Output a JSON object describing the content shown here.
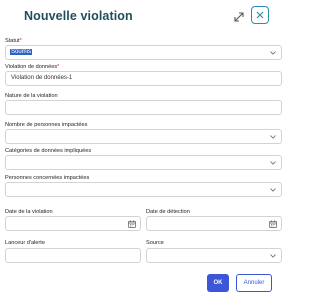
{
  "dialog": {
    "title": "Nouvelle violation",
    "ok_label": "OK",
    "cancel_label": "Annuler"
  },
  "fields": {
    "statut": {
      "label": "Statut",
      "required": "*",
      "value": "Soumis"
    },
    "violation": {
      "label": "Violation de données",
      "required": "*",
      "value": "Violation de données-1"
    },
    "nature": {
      "label": "Nature de la violation",
      "value": ""
    },
    "nb_personnes": {
      "label": "Nombre de personnes impactées",
      "value": ""
    },
    "categories": {
      "label": "Catégories de données impliquées",
      "value": ""
    },
    "personnes_concernees": {
      "label": "Personnes concernées impactées",
      "value": ""
    },
    "date_violation": {
      "label": "Date de la violation",
      "value": ""
    },
    "date_detection": {
      "label": "Date de détection",
      "value": ""
    },
    "lanceur": {
      "label": "Lanceur d'alerte",
      "value": ""
    },
    "source": {
      "label": "Source",
      "value": ""
    }
  },
  "colors": {
    "accent": "#3b56d9",
    "title": "#1f4e5c",
    "close_border": "#2a8fb0",
    "required": "#d0312d"
  },
  "icons": [
    "expand-icon",
    "close-icon",
    "chevron-down-icon",
    "calendar-icon"
  ]
}
